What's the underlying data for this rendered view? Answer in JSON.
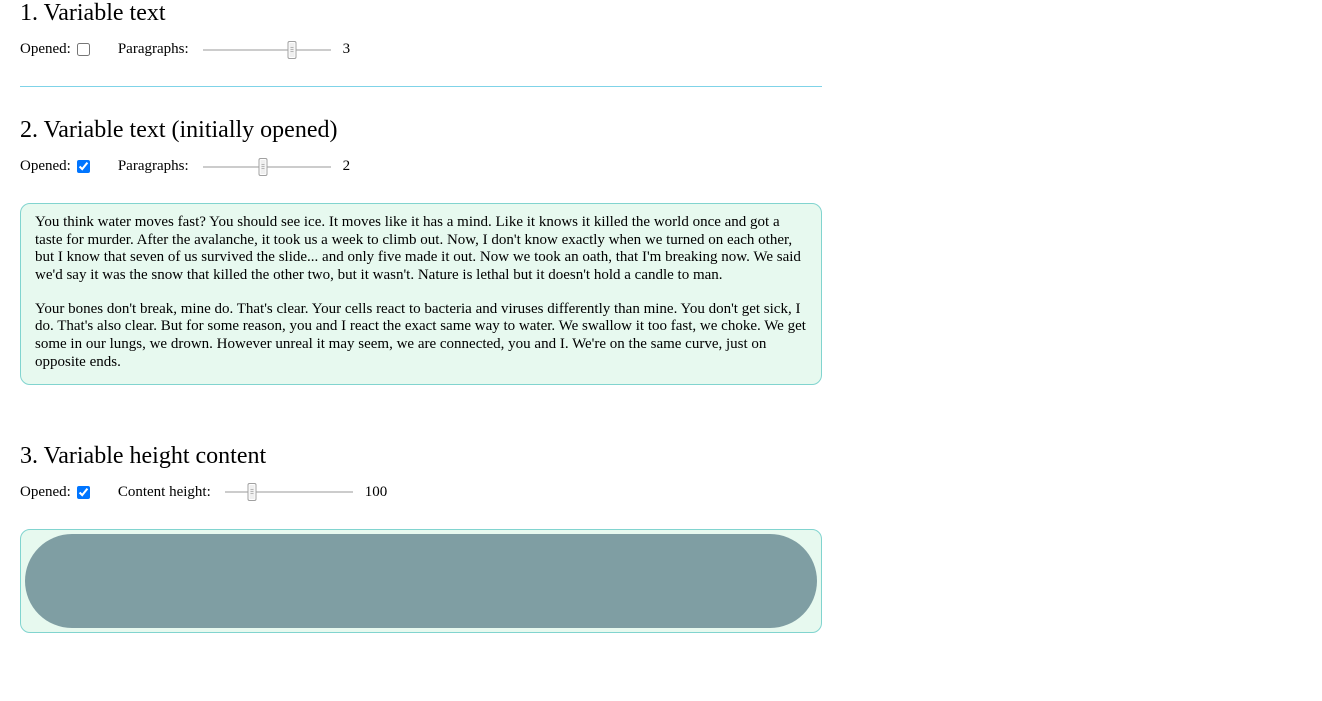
{
  "sections": [
    {
      "title": "1. Variable text",
      "opened_label": "Opened:",
      "opened": false,
      "param_label": "Paragraphs:",
      "slider_fraction": 0.7,
      "value": "3"
    },
    {
      "title": "2. Variable text (initially opened)",
      "opened_label": "Opened:",
      "opened": true,
      "param_label": "Paragraphs:",
      "slider_fraction": 0.47,
      "value": "2",
      "paragraphs": [
        "You think water moves fast? You should see ice. It moves like it has a mind. Like it knows it killed the world once and got a taste for murder. After the avalanche, it took us a week to climb out. Now, I don't know exactly when we turned on each other, but I know that seven of us survived the slide... and only five made it out. Now we took an oath, that I'm breaking now. We said we'd say it was the snow that killed the other two, but it wasn't. Nature is lethal but it doesn't hold a candle to man.",
        "Your bones don't break, mine do. That's clear. Your cells react to bacteria and viruses differently than mine. You don't get sick, I do. That's also clear. But for some reason, you and I react the exact same way to water. We swallow it too fast, we choke. We get some in our lungs, we drown. However unreal it may seem, we are connected, you and I. We're on the same curve, just on opposite ends."
      ]
    },
    {
      "title": "3. Variable height content",
      "opened_label": "Opened:",
      "opened": true,
      "param_label": "Content height:",
      "slider_fraction": 0.21,
      "value": "100",
      "content_height": 94
    }
  ]
}
